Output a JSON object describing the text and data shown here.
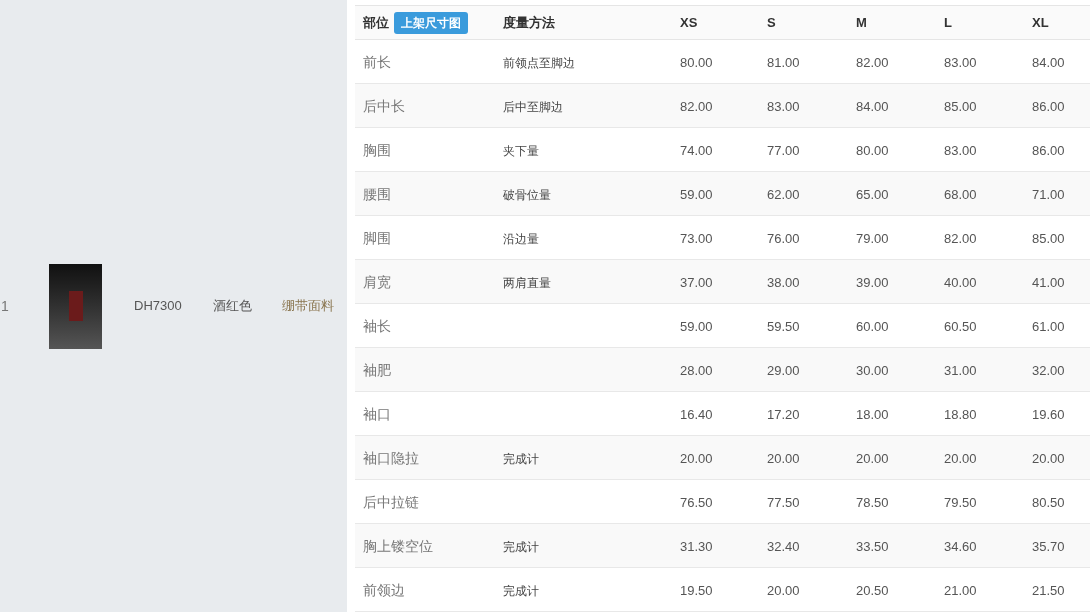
{
  "product": {
    "index": "1",
    "code": "DH7300",
    "color_name": "酒红色",
    "fabric": "绷带面料"
  },
  "table": {
    "columns": [
      {
        "label": "部位",
        "button": "上架尺寸图"
      },
      {
        "label": "度量方法"
      },
      {
        "label": "XS"
      },
      {
        "label": "S"
      },
      {
        "label": "M"
      },
      {
        "label": "L"
      },
      {
        "label": "XL"
      }
    ],
    "rows": [
      {
        "part": "前长",
        "method": "前领点至脚边",
        "values": [
          "80.00",
          "81.00",
          "82.00",
          "83.00",
          "84.00"
        ]
      },
      {
        "part": "后中长",
        "method": "后中至脚边",
        "values": [
          "82.00",
          "83.00",
          "84.00",
          "85.00",
          "86.00"
        ]
      },
      {
        "part": "胸围",
        "method": "夹下量",
        "values": [
          "74.00",
          "77.00",
          "80.00",
          "83.00",
          "86.00"
        ]
      },
      {
        "part": "腰围",
        "method": "破骨位量",
        "values": [
          "59.00",
          "62.00",
          "65.00",
          "68.00",
          "71.00"
        ]
      },
      {
        "part": "脚围",
        "method": "沿边量",
        "values": [
          "73.00",
          "76.00",
          "79.00",
          "82.00",
          "85.00"
        ]
      },
      {
        "part": "肩宽",
        "method": "两肩直量",
        "values": [
          "37.00",
          "38.00",
          "39.00",
          "40.00",
          "41.00"
        ]
      },
      {
        "part": "袖长",
        "values": [
          "59.00",
          "59.50",
          "60.00",
          "60.50",
          "61.00"
        ]
      },
      {
        "part": "袖肥",
        "values": [
          "28.00",
          "29.00",
          "30.00",
          "31.00",
          "32.00"
        ]
      },
      {
        "part": "袖口",
        "values": [
          "16.40",
          "17.20",
          "18.00",
          "18.80",
          "19.60"
        ]
      },
      {
        "part": "袖口隐拉",
        "method": "完成计",
        "values": [
          "20.00",
          "20.00",
          "20.00",
          "20.00",
          "20.00"
        ]
      },
      {
        "part": "后中拉链",
        "values": [
          "76.50",
          "77.50",
          "78.50",
          "79.50",
          "80.50"
        ]
      },
      {
        "part": "胸上镂空位",
        "method": "完成计",
        "values": [
          "31.30",
          "32.40",
          "33.50",
          "34.60",
          "35.70"
        ]
      },
      {
        "part": "前领边",
        "method": "完成计",
        "values": [
          "19.50",
          "20.00",
          "20.50",
          "21.00",
          "21.50"
        ]
      }
    ]
  }
}
